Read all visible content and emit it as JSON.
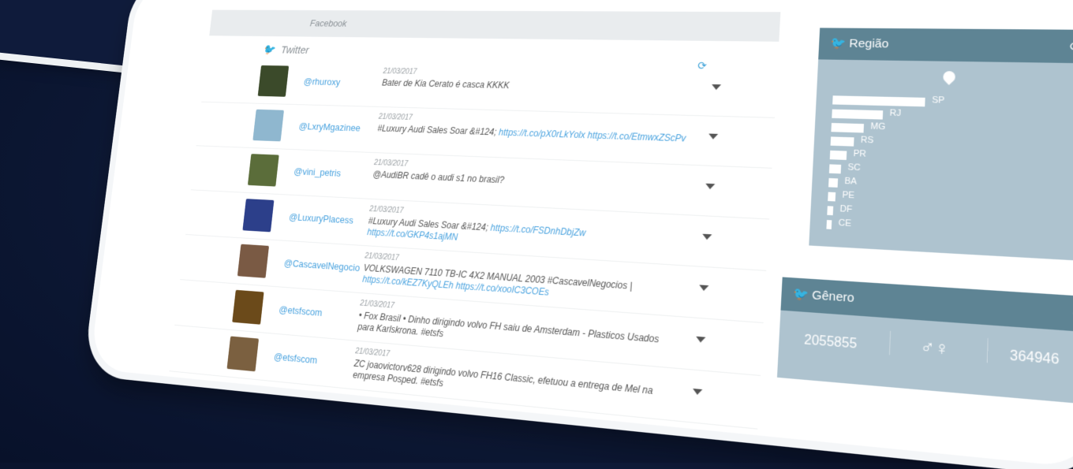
{
  "facebook": {
    "label": "Facebook"
  },
  "twitter": {
    "label": "Twitter"
  },
  "tweets": [
    {
      "handle": "@rhuroxy",
      "date": "21/03/2017",
      "text": "Bater de Kia Cerato é casca KKKK",
      "links": ""
    },
    {
      "handle": "@LxryMgazinee",
      "date": "21/03/2017",
      "text": "#Luxury Audi Sales Soar &#124;",
      "links": "https://t.co/pX0rLkYolx https://t.co/EtmwxZScPv"
    },
    {
      "handle": "@vini_petris",
      "date": "21/03/2017",
      "text": "@AudiBR cadê o audi s1 no brasil?",
      "links": ""
    },
    {
      "handle": "@LuxuryPlacess",
      "date": "21/03/2017",
      "text": "#Luxury Audi Sales Soar &#124;",
      "links": "https://t.co/FSDnhDbjZw https://t.co/GKP4s1ajMN"
    },
    {
      "handle": "@CascavelNegocio",
      "date": "21/03/2017",
      "text": "VOLKSWAGEN 7110 TB-IC 4X2 MANUAL 2003 #CascavelNegocios |",
      "links": "https://t.co/kEZ7KyQLEh https://t.co/xooIC3COEs"
    },
    {
      "handle": "@etsfscom",
      "date": "21/03/2017",
      "text": "• Fox Brasil • Dinho dirigindo volvo FH saiu de Amsterdam - Plasticos Usados para Karlskrona. #etsfs",
      "links": ""
    },
    {
      "handle": "@etsfscom",
      "date": "21/03/2017",
      "text": "ZC joaovictorv628 dirigindo volvo FH16 Classic, efetuou a entrega de Mel na empresa Posped. #etsfs",
      "links": ""
    }
  ],
  "regiao": {
    "title": "Região",
    "bars": [
      {
        "label": "SP",
        "value": 1.0
      },
      {
        "label": "RJ",
        "value": 0.55
      },
      {
        "label": "MG",
        "value": 0.35
      },
      {
        "label": "RS",
        "value": 0.25
      },
      {
        "label": "PR",
        "value": 0.18
      },
      {
        "label": "SC",
        "value": 0.13
      },
      {
        "label": "BA",
        "value": 0.1
      },
      {
        "label": "PE",
        "value": 0.08
      },
      {
        "label": "DF",
        "value": 0.06
      },
      {
        "label": "CE",
        "value": 0.05
      }
    ]
  },
  "genero": {
    "title": "Gênero",
    "male": "2055855",
    "female": "364946"
  },
  "colors": {
    "panel": "#aec3cf",
    "panel_header": "#5e8494",
    "link": "#4aa3df"
  },
  "icons": [
    "twitter-icon",
    "refresh-icon",
    "map-pin-icon",
    "male-female-icon",
    "caret-down-icon"
  ]
}
